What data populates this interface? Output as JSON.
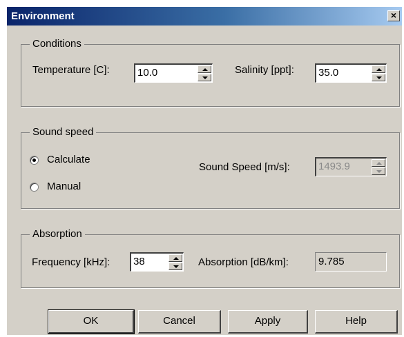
{
  "window": {
    "title": "Environment",
    "close_glyph": "×"
  },
  "conditions": {
    "legend": "Conditions",
    "temperature_label": "Temperature [C]:",
    "temperature_value": "10.0",
    "salinity_label": "Salinity [ppt]:",
    "salinity_value": "35.0"
  },
  "sound_speed": {
    "legend": "Sound speed",
    "calculate_label": "Calculate",
    "manual_label": "Manual",
    "selected": "Calculate",
    "speed_label": "Sound Speed [m/s]:",
    "speed_value": "1493.9"
  },
  "absorption": {
    "legend": "Absorption",
    "frequency_label": "Frequency [kHz]:",
    "frequency_value": "38",
    "absorption_label": "Absorption [dB/km]:",
    "absorption_value": "9.785"
  },
  "buttons": {
    "ok": "OK",
    "cancel": "Cancel",
    "apply": "Apply",
    "help": "Help"
  },
  "colors": {
    "face": "#d4d0c8",
    "title_start": "#0a246a",
    "title_end": "#a6caf0",
    "disabled_text": "#8a8a8a"
  },
  "icons": {
    "close": "close-icon",
    "spin_up": "arrow-up-icon",
    "spin_down": "arrow-down-icon"
  }
}
